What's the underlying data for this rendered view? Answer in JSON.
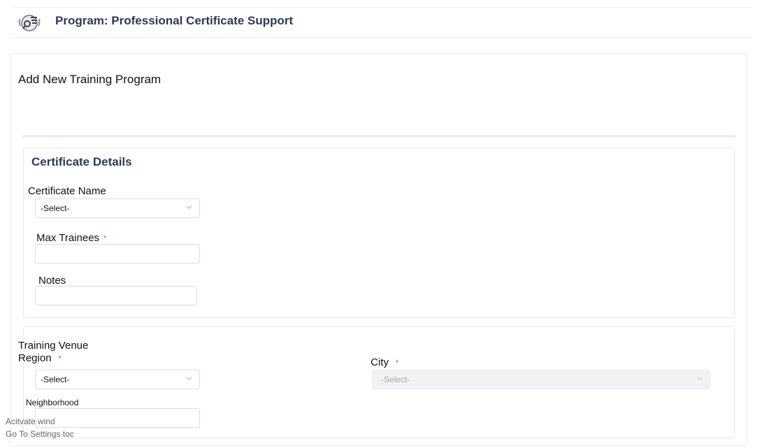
{
  "header": {
    "title": "Program: Professional Certificate Support",
    "logo_icon": "program-logo-icon"
  },
  "form": {
    "title": "Add New Training Program"
  },
  "certificate_section": {
    "heading": "Certificate Details",
    "certificate_name": {
      "label": "Certificate Name",
      "value": "-Select-"
    },
    "max_trainees": {
      "label": "Max Trainees",
      "required_mark": "*",
      "value": ""
    },
    "notes": {
      "label": "Notes",
      "value": ""
    }
  },
  "venue_section": {
    "heading": "Training Venue",
    "region": {
      "label": "Region",
      "required_mark": "*",
      "value": "-Select-"
    },
    "city": {
      "label": "City",
      "required_mark": "*",
      "value": "-Select-",
      "disabled": true
    },
    "neighborhood": {
      "label": "Neighborhood",
      "value": ""
    }
  },
  "watermark": {
    "line1": "Acitvate wind",
    "line2": "Go To Settings toc"
  },
  "colors": {
    "heading": "#2b3a55",
    "required": "#e0392b",
    "border": "#dcdcdc",
    "disabled_bg": "#f2f2f4"
  }
}
